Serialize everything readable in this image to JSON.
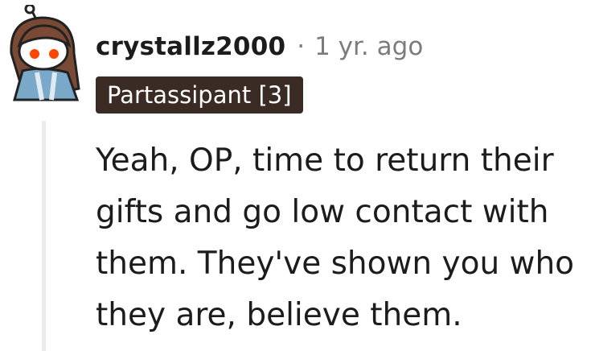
{
  "comment": {
    "author": "crystallz2000",
    "separator": "·",
    "timestamp": "1 yr. ago",
    "flair": "Partassipant [3]",
    "body": "Yeah, OP, time to return their gifts and go low contact with them. They've shown you who they are, believe them."
  },
  "colors": {
    "flair_bg": "#3a2b24",
    "thread_line": "#ebebeb",
    "muted_text": "#7c7c7c",
    "avatar_eyes": "#ff4500"
  },
  "icons": {
    "avatar": "snoo-avatar-long-brown-hair"
  }
}
